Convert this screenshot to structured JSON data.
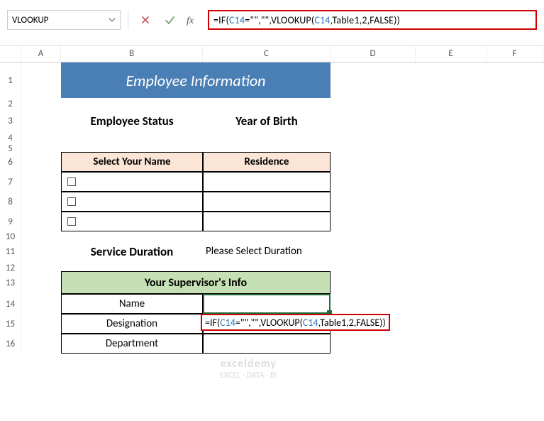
{
  "namebox": {
    "value": "VLOOKUP"
  },
  "formula_bar": {
    "prefix": "=IF(",
    "ref1": "C14",
    "mid1": "=\"\",\"\",VLOOKUP(",
    "ref2": "C14",
    "mid2": ",Table1,2,FALSE",
    "close": "))"
  },
  "columns": [
    "A",
    "B",
    "C",
    "D",
    "E",
    "F"
  ],
  "banner_title": "Employee Information",
  "section1": {
    "left": "Employee Status",
    "right": "Year of Birth"
  },
  "table1": {
    "head_left": "Select Your Name",
    "head_right": "Residence"
  },
  "section2": {
    "left": "Service Duration",
    "right": "Please Select Duration"
  },
  "table2": {
    "header": "Your Supervisor's Info",
    "rows": [
      "Name",
      "Designation",
      "Department"
    ]
  },
  "cell_formula": {
    "prefix": "=IF(",
    "ref1": "C14",
    "mid1": "=\"\",\"\",VLOOKUP(",
    "ref2": "C14",
    "mid2": ",Table1,2,FALSE",
    "close": "))"
  },
  "watermark": {
    "line1": "exceldemy",
    "line2": "EXCEL · DATA · BI"
  },
  "row_numbers": [
    "1",
    "2",
    "3",
    "4",
    "5",
    "6",
    "7",
    "8",
    "9",
    "10",
    "11",
    "12",
    "13",
    "14",
    "15",
    "16"
  ]
}
